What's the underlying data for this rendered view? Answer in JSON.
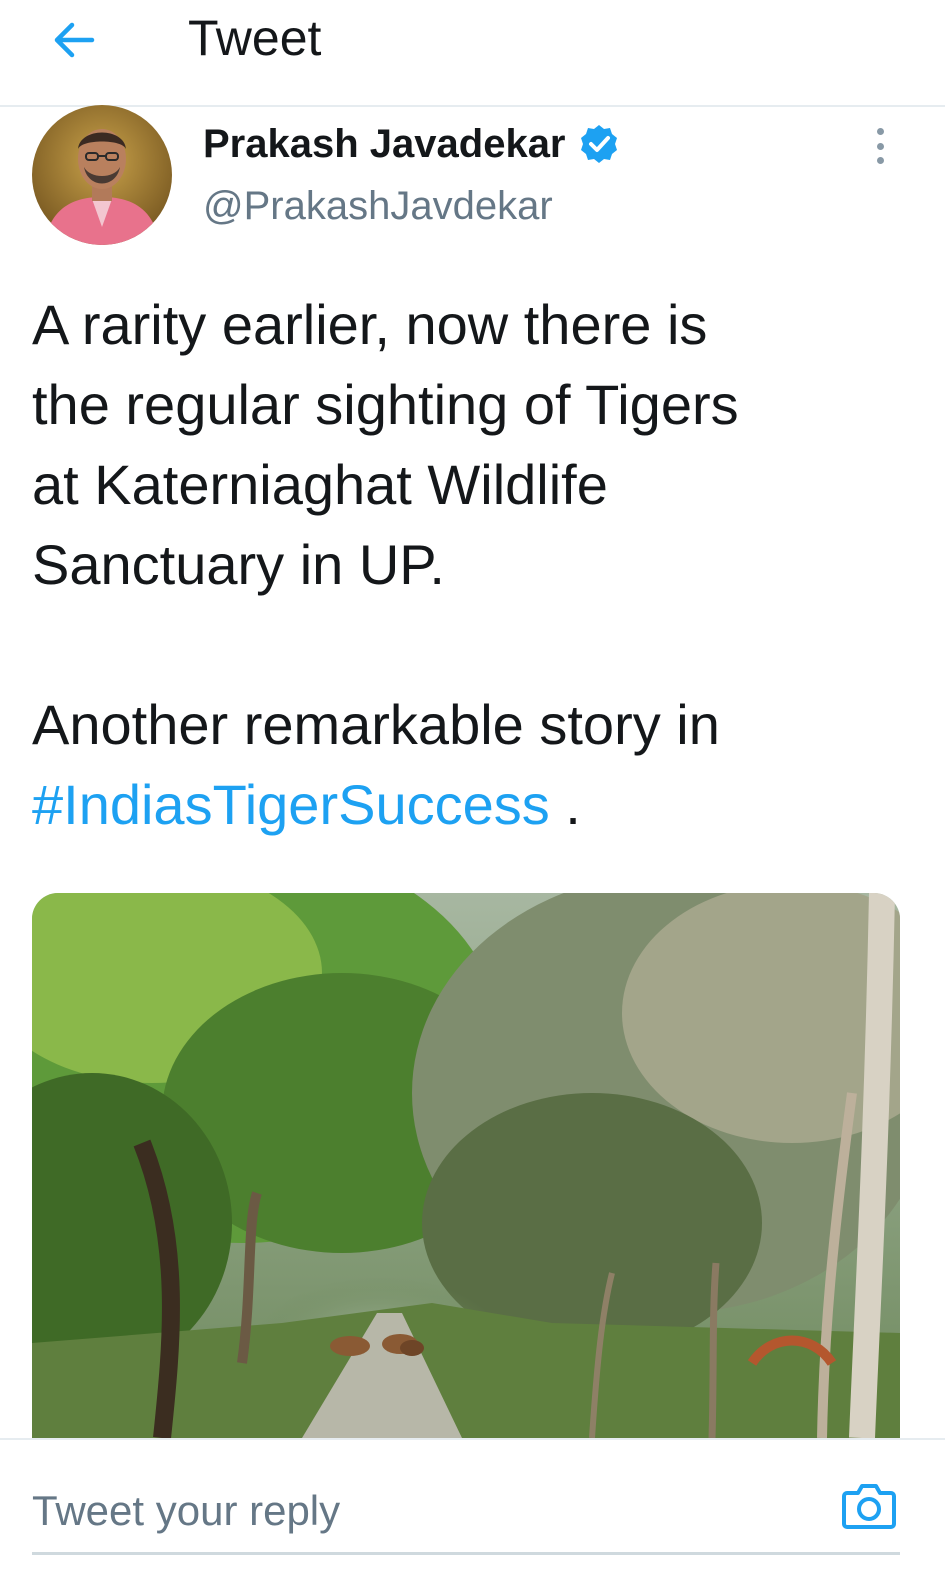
{
  "header": {
    "title": "Tweet",
    "back_icon": "back-arrow-icon"
  },
  "tweet": {
    "author": {
      "name": "Prakash Javadekar",
      "handle": "@PrakashJavdekar",
      "verified_icon": "verified-badge-icon",
      "avatar_icon": "avatar"
    },
    "more_icon": "more-vertical-icon",
    "text_para1_lines": [
      "A rarity earlier, now there is",
      "the regular sighting of Tigers",
      "at Katerniaghat Wildlife",
      "Sanctuary in UP."
    ],
    "text_para2_line1": "Another remarkable story in",
    "hashtag": "#IndiasTigerSuccess",
    "trailing": " ."
  },
  "reply": {
    "placeholder": "Tweet your reply",
    "camera_icon": "camera-icon"
  },
  "colors": {
    "accent": "#1da1f2",
    "text": "#14171a",
    "secondary": "#657786",
    "divider": "#e6ecf0"
  }
}
